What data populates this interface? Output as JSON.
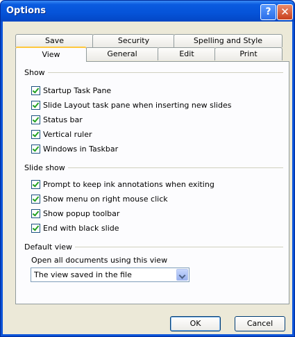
{
  "window": {
    "title": "Options",
    "help": "?",
    "close": "✕"
  },
  "tabs_top": [
    "Save",
    "Security",
    "Spelling and Style"
  ],
  "tabs_bottom": [
    "View",
    "General",
    "Edit",
    "Print"
  ],
  "show": {
    "label": "Show",
    "items": [
      {
        "label": "Startup Task Pane",
        "checked": true
      },
      {
        "label": "Slide Layout task pane when inserting new slides",
        "checked": true
      },
      {
        "label": "Status bar",
        "checked": true
      },
      {
        "label": "Vertical ruler",
        "checked": true
      },
      {
        "label": "Windows in Taskbar",
        "checked": true
      }
    ]
  },
  "slideshow": {
    "label": "Slide show",
    "items": [
      {
        "label": "Prompt to keep ink annotations when exiting",
        "checked": true
      },
      {
        "label": "Show menu on right mouse click",
        "checked": true
      },
      {
        "label": "Show popup toolbar",
        "checked": true
      },
      {
        "label": "End with black slide",
        "checked": true
      }
    ]
  },
  "default_view": {
    "label": "Default view",
    "open_label": "Open all documents using this view",
    "selected": "The view saved in the file"
  },
  "buttons": {
    "ok": "OK",
    "cancel": "Cancel"
  }
}
